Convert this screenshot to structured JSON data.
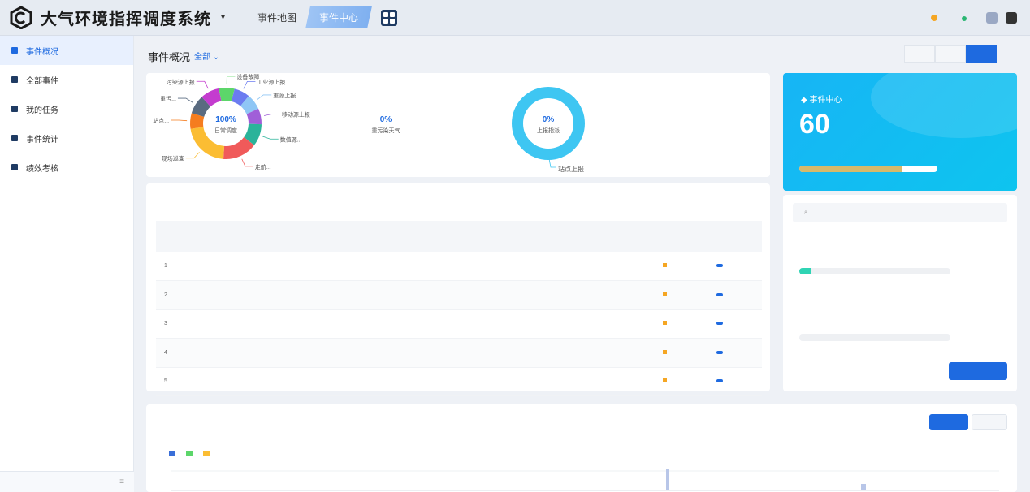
{
  "header": {
    "app_title": "大气环境指挥调度系统",
    "tabs": [
      {
        "label": "事件地图"
      },
      {
        "label": "事件中心"
      }
    ],
    "notice": "",
    "time": "",
    "date": "",
    "temperature": "",
    "weather": ""
  },
  "sidebar": {
    "items": [
      {
        "label": "事件概况"
      },
      {
        "label": "全部事件"
      },
      {
        "label": "我的任务"
      },
      {
        "label": "事件统计"
      },
      {
        "label": "绩效考核"
      }
    ]
  },
  "overview": {
    "title": "事件概况",
    "filter": "全部",
    "time_toggle": [
      "",
      "",
      ""
    ]
  },
  "donuts": [
    {
      "center_pct": "100%",
      "center_label": "日常调度",
      "slices": [
        {
          "label": "设备故障",
          "color": "#5cd66a"
        },
        {
          "label": "工业源上报",
          "color": "#6b7cf0"
        },
        {
          "label": "重源上报",
          "color": "#8fc6f5"
        },
        {
          "label": "移动源上报",
          "color": "#a05fd8"
        },
        {
          "label": "数值源...",
          "color": "#2bb39a"
        },
        {
          "label": "走航...",
          "color": "#f05a5a"
        },
        {
          "label": "现场巡查",
          "color": "#fbbd33"
        },
        {
          "label": "站点...",
          "color": "#f57d1f"
        },
        {
          "label": "重污...",
          "color": "#5a6b80"
        },
        {
          "label": "污染源上报",
          "color": "#c43ccf"
        }
      ]
    },
    {
      "center_pct": "0%",
      "center_label": "重污染天气"
    },
    {
      "center_pct": "0%",
      "center_label": "上报指派",
      "outer_label": "站点上报"
    }
  ],
  "event_center": {
    "title": "事件中心",
    "value": "60",
    "caption": "",
    "progress": 0.74,
    "progress_text": ""
  },
  "right_panel": {
    "search_placeholder": "",
    "metrics": [
      {
        "label": "",
        "value": "",
        "progress": 0.08,
        "side_1": "",
        "side_2": ""
      },
      {
        "label": "",
        "value": "",
        "progress": 0.0,
        "side_1": "",
        "side_2": ""
      }
    ],
    "button": ""
  },
  "tasks": {
    "title": "",
    "columns": [
      "",
      "",
      "",
      "",
      "",
      "",
      "",
      "",
      ""
    ],
    "rows": [
      [
        "1",
        "",
        "",
        "",
        "",
        "",
        "",
        "",
        ""
      ],
      [
        "2",
        "",
        "",
        "",
        "",
        "",
        "",
        "",
        ""
      ],
      [
        "3",
        "",
        "",
        "",
        "",
        "",
        "",
        "",
        ""
      ],
      [
        "4",
        "",
        "",
        "",
        "",
        "",
        "",
        "",
        ""
      ],
      [
        "5",
        "",
        "",
        "",
        "",
        "",
        "",
        "",
        ""
      ]
    ]
  },
  "bottom": {
    "title": "",
    "buttons": [
      "",
      ""
    ],
    "legend": [
      {
        "label": "",
        "color": "#3a6fd8"
      },
      {
        "label": "",
        "color": "#5cd66a"
      },
      {
        "label": "",
        "color": "#fbbd33"
      }
    ]
  }
}
